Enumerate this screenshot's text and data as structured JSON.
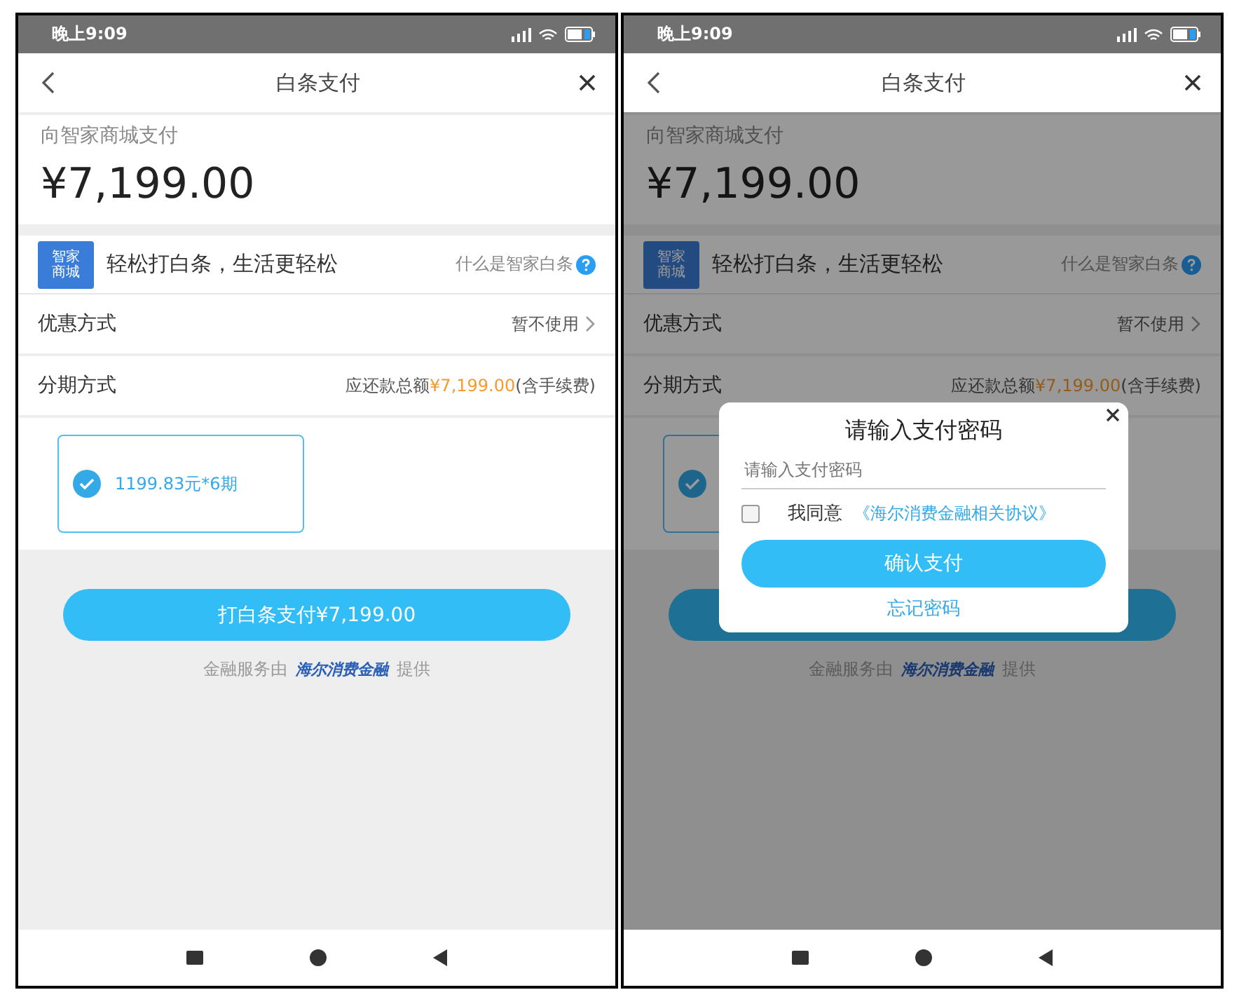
{
  "screens": [
    {
      "status_time": "晚上9:09",
      "nav": {
        "title": "白条支付"
      },
      "merchant": {
        "label": "向智家商城支付",
        "amount": "¥7,199.00"
      },
      "banner": {
        "logo_text": "智家商城",
        "slogan": "轻松打白条，生活更轻松",
        "help_link": "什么是智家白条"
      },
      "rows": [
        {
          "kind": "link",
          "label": "优惠方式",
          "value": "暂不使用"
        },
        {
          "kind": "total",
          "label": "分期方式",
          "value": "应还款总额",
          "highlight": "¥7,199.00",
          "note": "(含手续费)"
        }
      ],
      "plans": [
        {
          "label": "1199.83元*6期",
          "selected": true
        }
      ],
      "pay_button": {
        "label": "打白条支付¥7,199.00"
      },
      "footer": {
        "prefix": "金融服务由",
        "logo": "海尔消费金融",
        "suffix": "提供"
      }
    },
    {
      "status_time": "晚上9:09",
      "nav": {
        "title": "白条支付"
      },
      "merchant": {
        "label": "向智家商城支付",
        "amount": "¥7,199.00"
      },
      "banner": {
        "logo_text": "智家商城",
        "slogan": "轻松打白条，生活更轻松",
        "help_link": "什么是智家白条"
      },
      "rows": [
        {
          "kind": "link",
          "label": "优惠方式",
          "value": "暂不使用"
        },
        {
          "kind": "total",
          "label": "分期方式",
          "value": "应还款总额",
          "highlight": "¥7,199.00",
          "note": "(含手续费)"
        }
      ],
      "plans": [
        {
          "selected": true
        }
      ],
      "footer": {
        "prefix": "金融服务由",
        "logo": "海尔消费金融",
        "suffix": "提供"
      },
      "dialog": {
        "title": "请输入支付密码",
        "placeholder": "请输入支付密码",
        "agree": {
          "checked": false,
          "label": "我同意",
          "link": "《海尔消费金融相关协议》"
        },
        "confirm": "确认支付",
        "forgot": "忘记密码"
      }
    }
  ]
}
